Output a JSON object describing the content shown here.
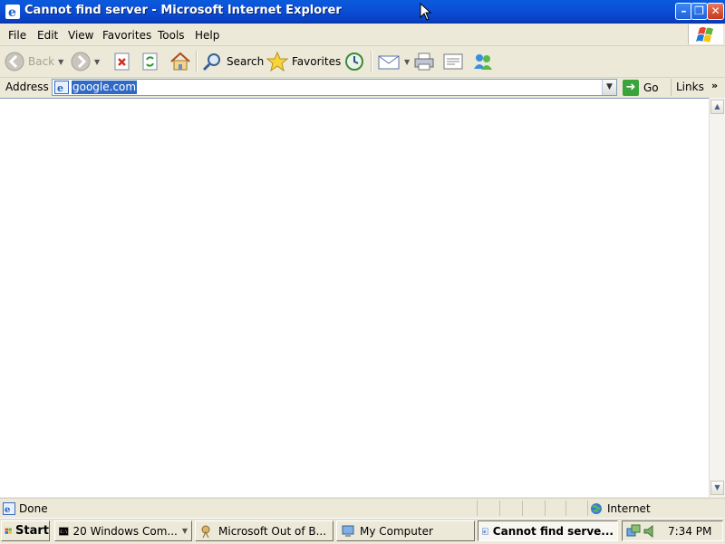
{
  "window": {
    "title": "Cannot find server - Microsoft Internet Explorer"
  },
  "menubar": {
    "items": [
      "File",
      "Edit",
      "View",
      "Favorites",
      "Tools",
      "Help"
    ]
  },
  "toolbar": {
    "back": "Back",
    "search": "Search",
    "favorites": "Favorites"
  },
  "addressbar": {
    "label": "Address",
    "url": "google.com",
    "go": "Go",
    "links": "Links"
  },
  "statusbar": {
    "text": "Done",
    "zone": "Internet"
  },
  "taskbar": {
    "start": "Start",
    "tasks": [
      {
        "label": "20 Windows Com..."
      },
      {
        "label": "Microsoft Out of B..."
      },
      {
        "label": "My Computer"
      },
      {
        "label": "Cannot find serve..."
      }
    ],
    "clock": "7:34 PM"
  }
}
